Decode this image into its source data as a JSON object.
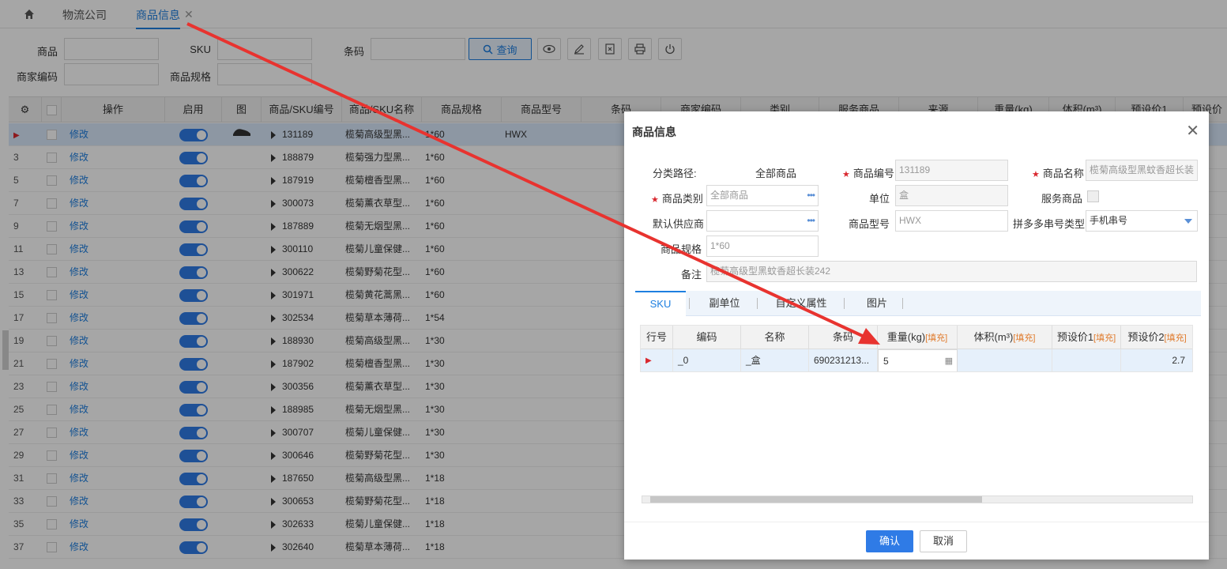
{
  "tabs": [
    {
      "label": "物流公司"
    },
    {
      "label": "商品信息"
    }
  ],
  "search": {
    "labels": [
      "商品",
      "SKU",
      "条码",
      "商家编码",
      "商品规格"
    ],
    "query_label": "查询"
  },
  "grid": {
    "headers": [
      "操作",
      "启用",
      "图",
      "商品/SKU编号",
      "商品/SKU名称",
      "商品规格",
      "商品型号",
      "条码",
      "商家编码",
      "类别",
      "服务商品",
      "来源",
      "重量(kg)",
      "体积(m³)",
      "预设价1",
      "预设价"
    ],
    "edit_label": "修改",
    "rows": [
      {
        "no": "",
        "code": "131189",
        "name": "榄菊高级型黑...",
        "spec": "1*60",
        "model": "HWX"
      },
      {
        "no": "3",
        "code": "188879",
        "name": "榄菊强力型黑...",
        "spec": "1*60",
        "model": ""
      },
      {
        "no": "5",
        "code": "187919",
        "name": "榄菊檀香型黑...",
        "spec": "1*60",
        "model": ""
      },
      {
        "no": "7",
        "code": "300073",
        "name": "榄菊薰衣草型...",
        "spec": "1*60",
        "model": ""
      },
      {
        "no": "9",
        "code": "187889",
        "name": "榄菊无烟型黑...",
        "spec": "1*60",
        "model": ""
      },
      {
        "no": "11",
        "code": "300110",
        "name": "榄菊儿童保健...",
        "spec": "1*60",
        "model": ""
      },
      {
        "no": "13",
        "code": "300622",
        "name": "榄菊野菊花型...",
        "spec": "1*60",
        "model": ""
      },
      {
        "no": "15",
        "code": "301971",
        "name": "榄菊黄花蒿黑...",
        "spec": "1*60",
        "model": ""
      },
      {
        "no": "17",
        "code": "302534",
        "name": "榄菊草本薄荷...",
        "spec": "1*54",
        "model": ""
      },
      {
        "no": "19",
        "code": "188930",
        "name": "榄菊高级型黑...",
        "spec": "1*30",
        "model": ""
      },
      {
        "no": "21",
        "code": "187902",
        "name": "榄菊檀香型黑...",
        "spec": "1*30",
        "model": ""
      },
      {
        "no": "23",
        "code": "300356",
        "name": "榄菊薰衣草型...",
        "spec": "1*30",
        "model": ""
      },
      {
        "no": "25",
        "code": "188985",
        "name": "榄菊无烟型黑...",
        "spec": "1*30",
        "model": ""
      },
      {
        "no": "27",
        "code": "300707",
        "name": "榄菊儿童保健...",
        "spec": "1*30",
        "model": ""
      },
      {
        "no": "29",
        "code": "300646",
        "name": "榄菊野菊花型...",
        "spec": "1*30",
        "model": ""
      },
      {
        "no": "31",
        "code": "187650",
        "name": "榄菊高级型黑...",
        "spec": "1*18",
        "model": ""
      },
      {
        "no": "33",
        "code": "300653",
        "name": "榄菊野菊花型...",
        "spec": "1*18",
        "model": ""
      },
      {
        "no": "35",
        "code": "302633",
        "name": "榄菊儿童保健...",
        "spec": "1*18",
        "model": ""
      },
      {
        "no": "37",
        "code": "302640",
        "name": "榄菊草本薄荷...",
        "spec": "1*18",
        "model": ""
      }
    ]
  },
  "modal": {
    "title": "商品信息",
    "category_path_label": "分类路径:",
    "category_path_value": "全部商品",
    "code_label": "商品编号",
    "code_value": "131189",
    "name_label": "商品名称",
    "name_value": "榄菊高级型黑蚊香超长装",
    "category_label": "商品类别",
    "category_value": "全部商品",
    "unit_label": "单位",
    "unit_value": "盒",
    "service_label": "服务商品",
    "supplier_label": "默认供应商",
    "model_label": "商品型号",
    "model_value": "HWX",
    "pdd_label": "拼多多串号类型",
    "pdd_value": "手机串号",
    "spec_label": "商品规格",
    "spec_value": "1*60",
    "remark_label": "备注",
    "remark_value": "榄菊高级型黑蚊香超长装242",
    "tabs": [
      "SKU",
      "副单位",
      "自定义属性",
      "图片"
    ],
    "sku_headers": [
      "行号",
      "编码",
      "名称",
      "条码",
      "重量(kg)",
      "体积(m³)",
      "预设价1",
      "预设价2"
    ],
    "fill_label": "[填充]",
    "sku_row": {
      "code": "_0",
      "name": "_盒",
      "barcode": "690231213...",
      "weight": "5",
      "price2": "2.7"
    },
    "ok_label": "确认",
    "cancel_label": "取消"
  },
  "colors": {
    "accent": "#1e7fe0",
    "arrow": "#e8332f"
  }
}
